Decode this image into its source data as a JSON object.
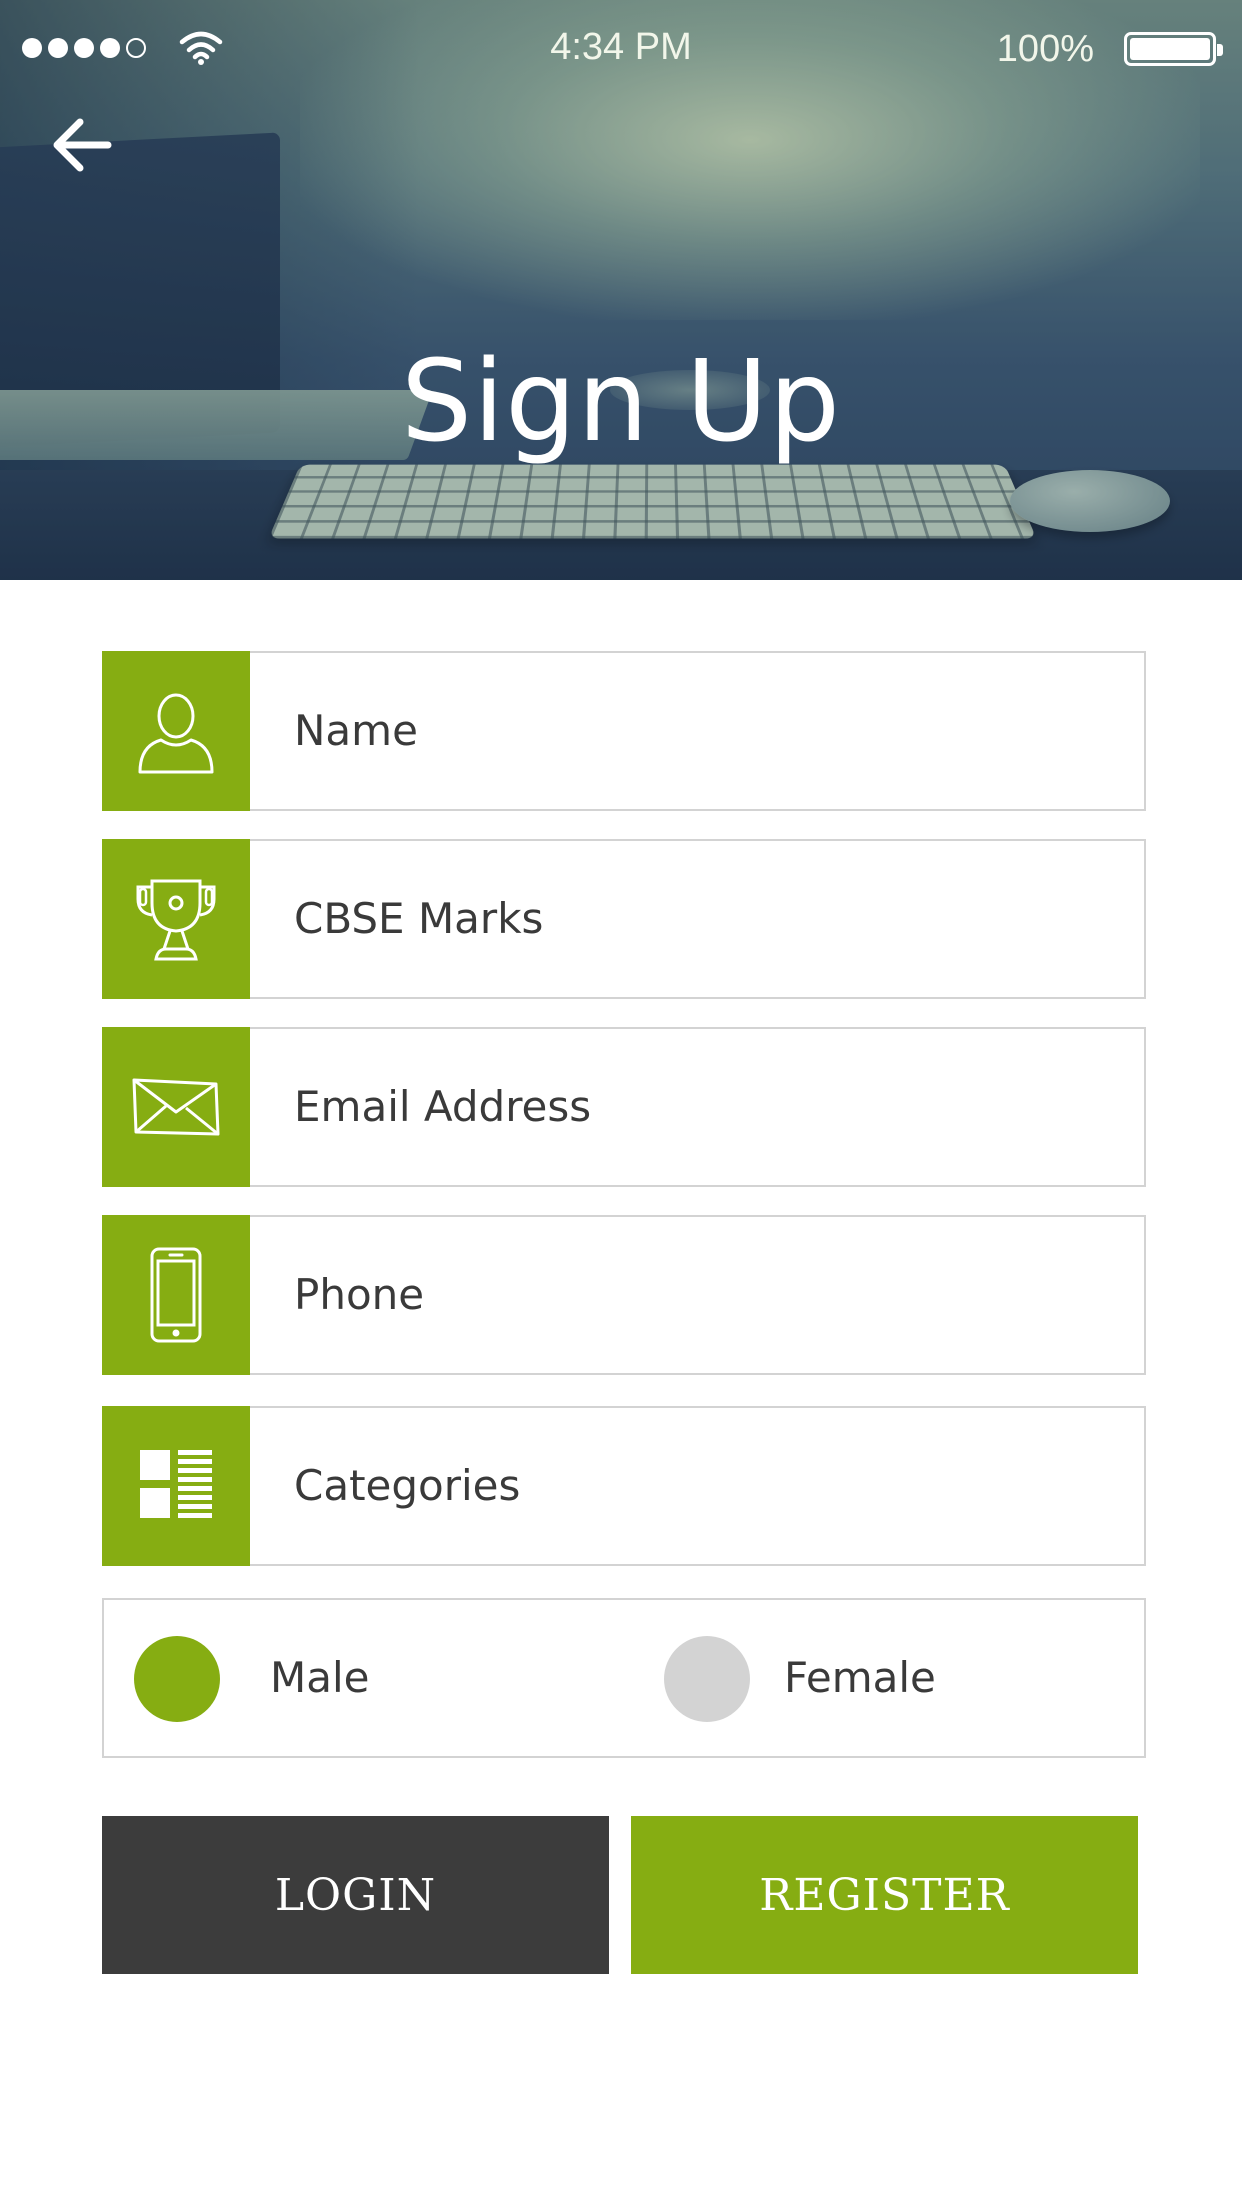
{
  "status_bar": {
    "time": "4:34 PM",
    "battery": "100%",
    "icons": [
      "signal-dots-icon",
      "wifi-icon",
      "battery-icon"
    ]
  },
  "header": {
    "back_icon": "arrow-left-icon",
    "title": "Sign Up"
  },
  "form": {
    "fields": [
      {
        "icon": "user-icon",
        "placeholder": "Name"
      },
      {
        "icon": "trophy-icon",
        "placeholder": "CBSE Marks"
      },
      {
        "icon": "envelope-icon",
        "placeholder": "Email Address"
      },
      {
        "icon": "phone-icon",
        "placeholder": "Phone"
      },
      {
        "icon": "categories-icon",
        "placeholder": "Categories"
      }
    ],
    "gender": {
      "options": [
        "Male",
        "Female"
      ],
      "selected": "Male"
    }
  },
  "buttons": {
    "login": "LOGIN",
    "register": "REGISTER"
  },
  "colors": {
    "accent": "#86ad12",
    "dark_button": "#3c3c3c",
    "border": "#d3d3d3",
    "text": "#3a3a3a",
    "radio_unselected": "#d3d3d3"
  }
}
